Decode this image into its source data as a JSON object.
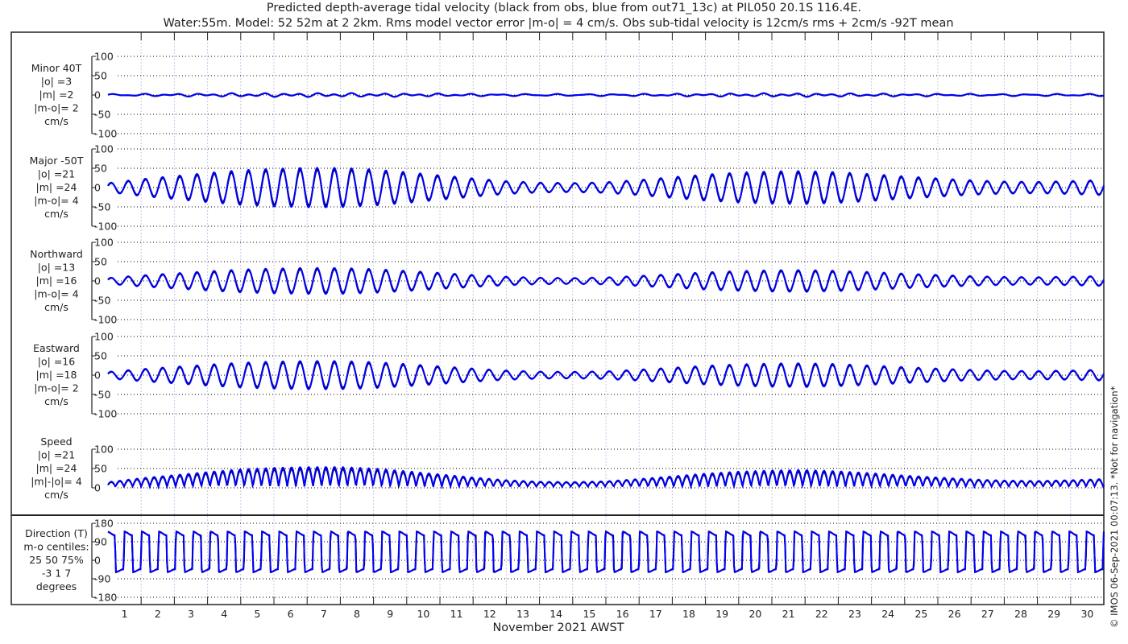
{
  "chart_data": {
    "type": "line",
    "title_line1": "Predicted depth-average tidal velocity (black from obs, blue from out71_13c) at PIL050 20.1S 116.4E.",
    "title_line2": "Water:55m. Model: 52 52m at 2 2km. Rms model vector error |m-o| = 4 cm/s. Obs sub-tidal velocity is 12cm/s rms + 2cm/s -92T mean",
    "xlabel": "November 2021 AWST",
    "x_tick_labels": [
      "1",
      "2",
      "3",
      "4",
      "5",
      "6",
      "7",
      "8",
      "9",
      "10",
      "11",
      "12",
      "13",
      "14",
      "15",
      "16",
      "17",
      "18",
      "19",
      "20",
      "21",
      "22",
      "23",
      "24",
      "25",
      "26",
      "27",
      "28",
      "29",
      "30"
    ],
    "xlim_days": [
      0,
      30
    ],
    "grid": true,
    "series_legend": {
      "obs": "black",
      "model": "blue"
    },
    "tidal_period_hours": 12.42,
    "spring_neap_amplitude_by_day_major": [
      12,
      22,
      30,
      38,
      45,
      49,
      51,
      51,
      47,
      40,
      32,
      24,
      17,
      13,
      12,
      14,
      20,
      27,
      34,
      39,
      42,
      43,
      40,
      35,
      29,
      24,
      19,
      16,
      15,
      17,
      20
    ],
    "panels": [
      {
        "id": "minor",
        "label_lines": [
          "Minor 40T",
          "|o| =3",
          "|m| =2",
          "|m-o|= 2",
          "cm/s"
        ],
        "yticks": [
          "100",
          "50",
          "0",
          "-50",
          "-100"
        ],
        "ylim": [
          -100,
          100
        ],
        "amplitude_scale": 0.07
      },
      {
        "id": "major",
        "label_lines": [
          "Major -50T",
          "|o| =21",
          "|m| =24",
          "|m-o|= 4",
          "cm/s"
        ],
        "yticks": [
          "100",
          "50",
          "0",
          "-50",
          "-100"
        ],
        "ylim": [
          -100,
          100
        ],
        "amplitude_scale": 1.0
      },
      {
        "id": "northward",
        "label_lines": [
          "Northward",
          "|o| =13",
          "|m| =16",
          "|m-o|= 4",
          "cm/s"
        ],
        "yticks": [
          "100",
          "50",
          "0",
          "-50",
          "-100"
        ],
        "ylim": [
          -100,
          100
        ],
        "amplitude_scale": 0.66
      },
      {
        "id": "eastward",
        "label_lines": [
          "Eastward",
          "|o| =16",
          "|m| =18",
          "|m-o|= 2",
          "cm/s"
        ],
        "yticks": [
          "100",
          "50",
          "0",
          "-50",
          "-100"
        ],
        "ylim": [
          -100,
          100
        ],
        "amplitude_scale": 0.72
      },
      {
        "id": "speed",
        "label_lines": [
          "Speed",
          "|o| =21",
          "|m| =24",
          "|m|-|o|= 4",
          "cm/s"
        ],
        "yticks": [
          "100",
          "50",
          "0"
        ],
        "ylim": [
          0,
          100
        ],
        "amplitude_scale": 1.0
      },
      {
        "id": "direction",
        "label_lines": [
          "Direction (T)",
          "m-o centiles:",
          "25  50  75%",
          "-3  1  7",
          "degrees"
        ],
        "yticks": [
          "180",
          "90",
          "0",
          "-90",
          "-180"
        ],
        "ylim": [
          -180,
          180
        ],
        "flood_direction": 130,
        "ebb_direction": -50
      }
    ],
    "copyright": "© IMOS 06-Sep-2021 00:07:13. *Not for navigation*",
    "colors": {
      "obs": "#000000",
      "model": "#0000ff",
      "grid": "#000000",
      "day_grid": "#c8c8e8"
    }
  }
}
